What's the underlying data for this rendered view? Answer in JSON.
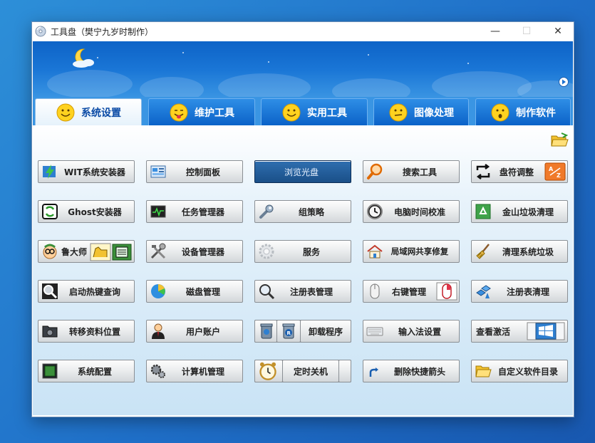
{
  "window": {
    "title": "工具盘（樊宁九岁时制作）",
    "minimize": "—",
    "maximize": "☐",
    "close": "✕"
  },
  "tabs": [
    {
      "label": "系统设置",
      "active": true
    },
    {
      "label": "维护工具",
      "active": false
    },
    {
      "label": "实用工具",
      "active": false
    },
    {
      "label": "图像处理",
      "active": false
    },
    {
      "label": "制作软件",
      "active": false
    }
  ],
  "grid": {
    "row1": [
      "WIT系统安装器",
      "控制面板",
      "浏览光盘",
      "搜索工具",
      "盘符调整"
    ],
    "row2": [
      "Ghost安装器",
      "任务管理器",
      "组策略",
      "电脑时间校准",
      "金山垃圾清理"
    ],
    "row3": [
      "鲁大师",
      "设备管理器",
      "服务",
      "局域网共享修复",
      "清理系统垃圾"
    ],
    "row4": [
      "启动热键查询",
      "磁盘管理",
      "注册表管理",
      "右键管理",
      "注册表清理"
    ],
    "row5": [
      "转移资料位置",
      "用户账户",
      "卸载程序",
      "输入法设置",
      "查看激活"
    ],
    "row6": [
      "系统配置",
      "计算机管理",
      "定时关机",
      "删除快捷箭头",
      "自定义软件目录"
    ]
  },
  "colors": {
    "banner": "#1a76d6",
    "tab_inactive": "#0b62c8",
    "accent_dark_button": "#1a4f88"
  }
}
